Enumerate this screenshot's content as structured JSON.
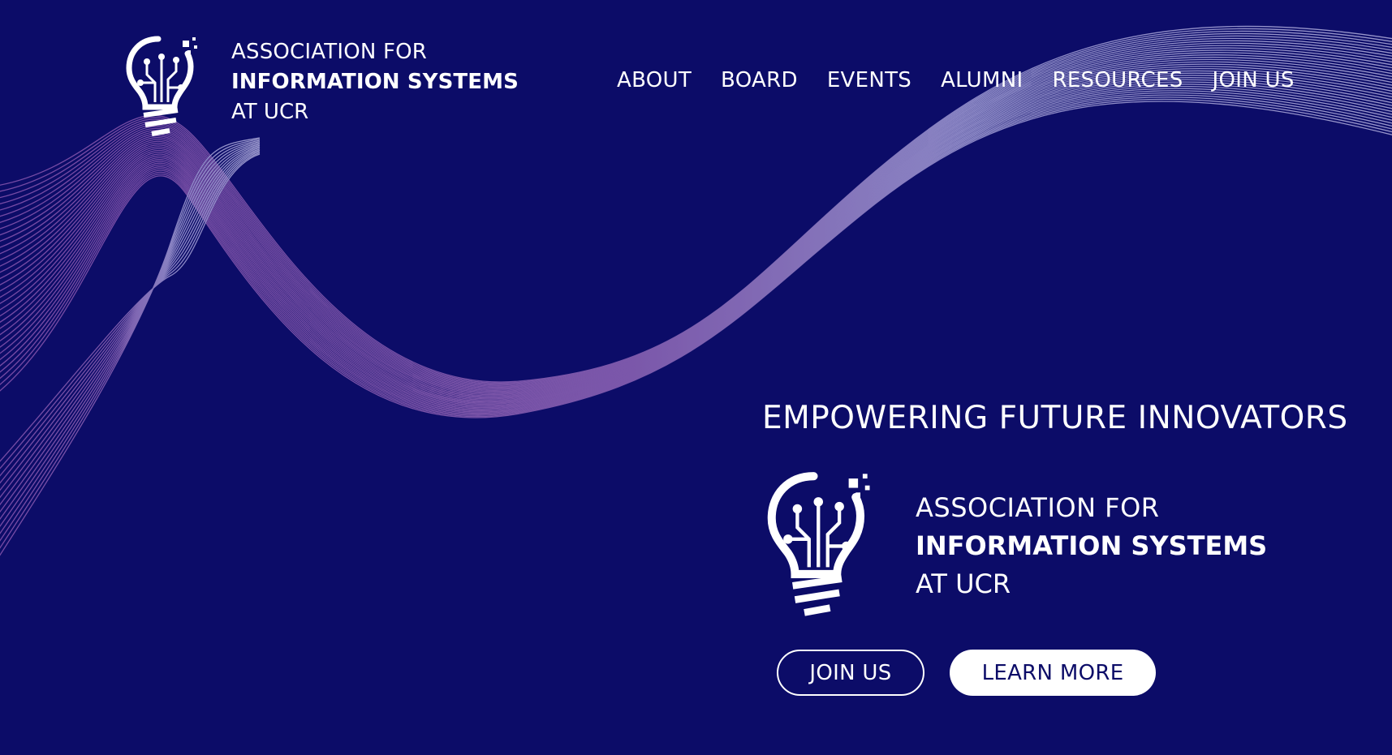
{
  "brand": {
    "line1": "ASSOCIATION FOR",
    "line2": "INFORMATION SYSTEMS",
    "line3": "AT UCR"
  },
  "nav": {
    "items": [
      "ABOUT",
      "BOARD",
      "EVENTS",
      "ALUMNI",
      "RESOURCES",
      "JOIN US"
    ]
  },
  "hero": {
    "title": "EMPOWERING FUTURE INNOVATORS",
    "logo_line1": "ASSOCIATION FOR",
    "logo_line2": "INFORMATION SYSTEMS",
    "logo_line3": "AT UCR",
    "join_label": "JOIN US",
    "learn_more_label": "LEARN MORE"
  },
  "colors": {
    "background": "#0c0c68",
    "wave_violet": "#9a5fb8",
    "wave_lavender": "#b7b3e6",
    "text": "#ffffff"
  }
}
